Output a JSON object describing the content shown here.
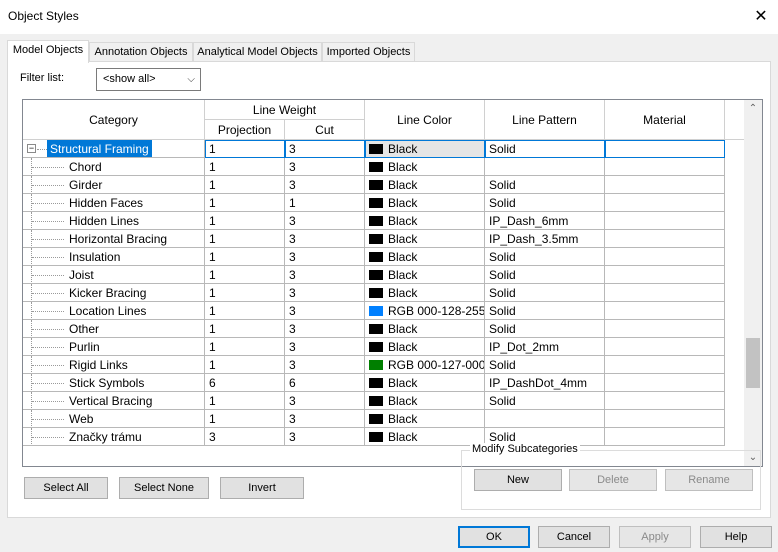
{
  "window": {
    "title": "Object Styles",
    "close_glyph": "✕"
  },
  "tabs": [
    {
      "label": "Model Objects",
      "active": true
    },
    {
      "label": "Annotation Objects",
      "active": false
    },
    {
      "label": "Analytical Model Objects",
      "active": false
    },
    {
      "label": "Imported Objects",
      "active": false
    }
  ],
  "filter": {
    "label": "Filter list:",
    "value": "<show all>"
  },
  "grid": {
    "headers": {
      "category": "Category",
      "line_weight": "Line Weight",
      "projection": "Projection",
      "cut": "Cut",
      "line_color": "Line Color",
      "line_pattern": "Line Pattern",
      "material": "Material"
    },
    "rows": [
      {
        "category": "Structural Framing",
        "projection": "1",
        "cut": "3",
        "color_name": "Black",
        "color": "#000000",
        "pattern": "Solid",
        "material": "",
        "parent": true,
        "selected": true
      },
      {
        "category": "Chord",
        "projection": "1",
        "cut": "3",
        "color_name": "Black",
        "color": "#000000",
        "pattern": "",
        "material": ""
      },
      {
        "category": "Girder",
        "projection": "1",
        "cut": "3",
        "color_name": "Black",
        "color": "#000000",
        "pattern": "Solid",
        "material": ""
      },
      {
        "category": "Hidden Faces",
        "projection": "1",
        "cut": "1",
        "color_name": "Black",
        "color": "#000000",
        "pattern": "Solid",
        "material": ""
      },
      {
        "category": "Hidden Lines",
        "projection": "1",
        "cut": "3",
        "color_name": "Black",
        "color": "#000000",
        "pattern": "IP_Dash_6mm",
        "material": ""
      },
      {
        "category": "Horizontal Bracing",
        "projection": "1",
        "cut": "3",
        "color_name": "Black",
        "color": "#000000",
        "pattern": "IP_Dash_3.5mm",
        "material": ""
      },
      {
        "category": "Insulation",
        "projection": "1",
        "cut": "3",
        "color_name": "Black",
        "color": "#000000",
        "pattern": "Solid",
        "material": ""
      },
      {
        "category": "Joist",
        "projection": "1",
        "cut": "3",
        "color_name": "Black",
        "color": "#000000",
        "pattern": "Solid",
        "material": ""
      },
      {
        "category": "Kicker Bracing",
        "projection": "1",
        "cut": "3",
        "color_name": "Black",
        "color": "#000000",
        "pattern": "Solid",
        "material": ""
      },
      {
        "category": "Location Lines",
        "projection": "1",
        "cut": "3",
        "color_name": "RGB 000-128-255",
        "color": "#0080ff",
        "pattern": "Solid",
        "material": ""
      },
      {
        "category": "Other",
        "projection": "1",
        "cut": "3",
        "color_name": "Black",
        "color": "#000000",
        "pattern": "Solid",
        "material": ""
      },
      {
        "category": "Purlin",
        "projection": "1",
        "cut": "3",
        "color_name": "Black",
        "color": "#000000",
        "pattern": "IP_Dot_2mm",
        "material": ""
      },
      {
        "category": "Rigid Links",
        "projection": "1",
        "cut": "3",
        "color_name": "RGB 000-127-000",
        "color": "#007f00",
        "pattern": "Solid",
        "material": ""
      },
      {
        "category": "Stick Symbols",
        "projection": "6",
        "cut": "6",
        "color_name": "Black",
        "color": "#000000",
        "pattern": "IP_DashDot_4mm",
        "material": ""
      },
      {
        "category": "Vertical Bracing",
        "projection": "1",
        "cut": "3",
        "color_name": "Black",
        "color": "#000000",
        "pattern": "Solid",
        "material": ""
      },
      {
        "category": "Web",
        "projection": "1",
        "cut": "3",
        "color_name": "Black",
        "color": "#000000",
        "pattern": "",
        "material": ""
      },
      {
        "category": "Značky trámu",
        "projection": "3",
        "cut": "3",
        "color_name": "Black",
        "color": "#000000",
        "pattern": "Solid",
        "material": ""
      }
    ]
  },
  "buttons": {
    "select_all": "Select All",
    "select_none": "Select None",
    "invert": "Invert",
    "modify_title": "Modify Subcategories",
    "new": "New",
    "delete": "Delete",
    "rename": "Rename",
    "ok": "OK",
    "cancel": "Cancel",
    "apply": "Apply",
    "help": "Help"
  },
  "colors": {
    "selection": "#0078d7",
    "accent_blue": "#0080ff",
    "accent_green": "#007f00"
  },
  "icons": {
    "close": "close-icon",
    "collapse": "minus-box-icon",
    "scroll_up": "chevron-up-icon",
    "scroll_down": "chevron-down-icon",
    "dropdown": "chevron-down-icon"
  }
}
